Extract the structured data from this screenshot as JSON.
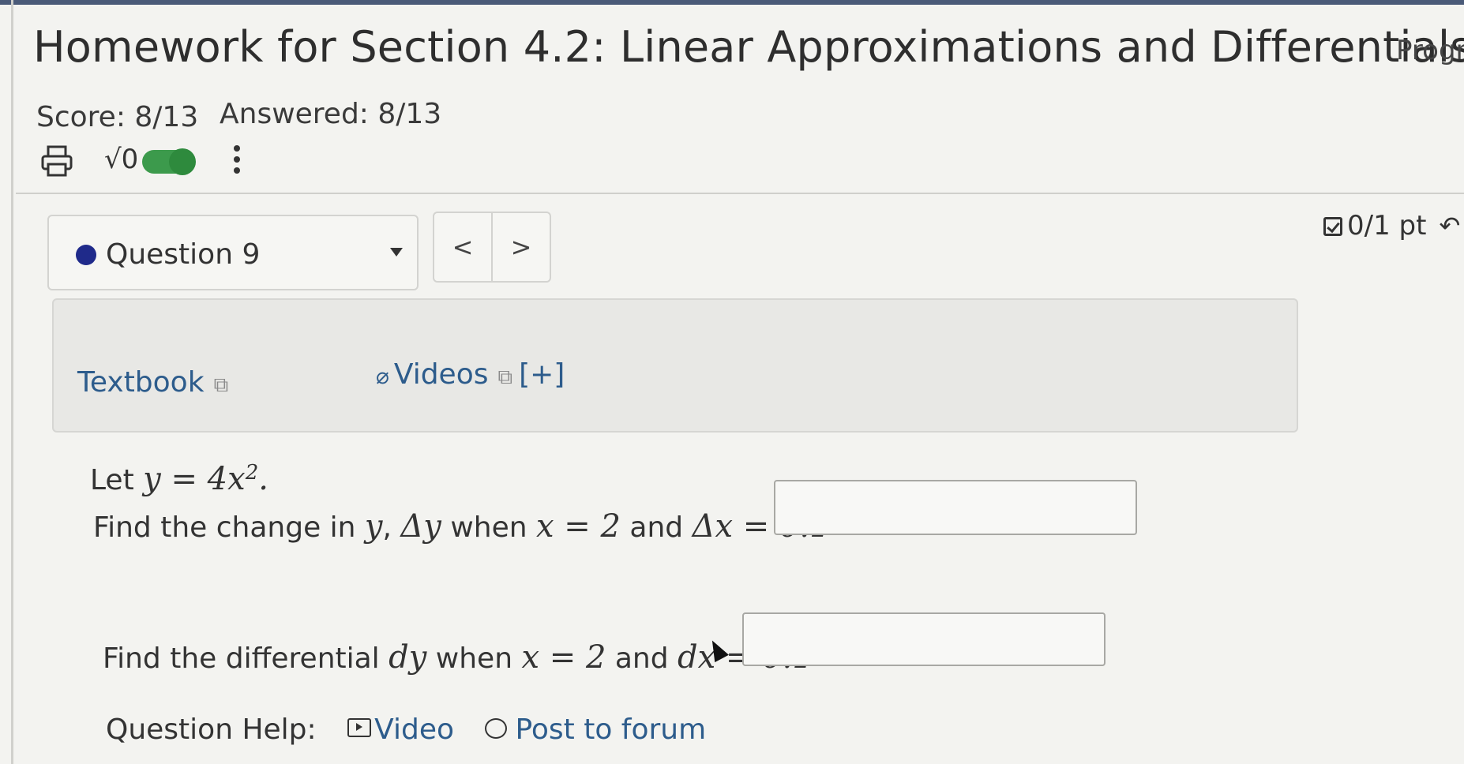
{
  "header": {
    "title": "Homework for Section 4.2: Linear Approximations and Differentials",
    "progress_label": "Progr"
  },
  "stats": {
    "score": "Score: 8/13",
    "answered": "Answered: 8/13"
  },
  "toolbar": {
    "sqrt_label": "√0",
    "toggle_state": "on",
    "accent": "#3c9a4c"
  },
  "question_nav": {
    "selected": "Question 9",
    "prev": "<",
    "next": ">",
    "points": "0/1 pt",
    "status_color": "#1f2a8a"
  },
  "resources": {
    "textbook": "Textbook",
    "videos": "Videos",
    "videos_expand": "[+]"
  },
  "problem": {
    "let_word": "Let",
    "given": "y = 4x",
    "given_exp": "2",
    "given_end": ".",
    "q1_text": "Find the change in ",
    "q1_y": "y",
    "q1_sep": ", ",
    "q1_dy": "Δy",
    "q1_when": " when ",
    "q1_x": "x = 2",
    "q1_and": " and ",
    "q1_dx": "Δx = 0.1",
    "q1_answer": "",
    "q2_text": "Find the differential ",
    "q2_dy": "dy",
    "q2_when": " when ",
    "q2_x": "x = 2",
    "q2_and": " and ",
    "q2_dx": "dx = 0.1",
    "q2_answer": ""
  },
  "help": {
    "label": "Question Help:",
    "video": "Video",
    "forum": "Post to forum"
  }
}
